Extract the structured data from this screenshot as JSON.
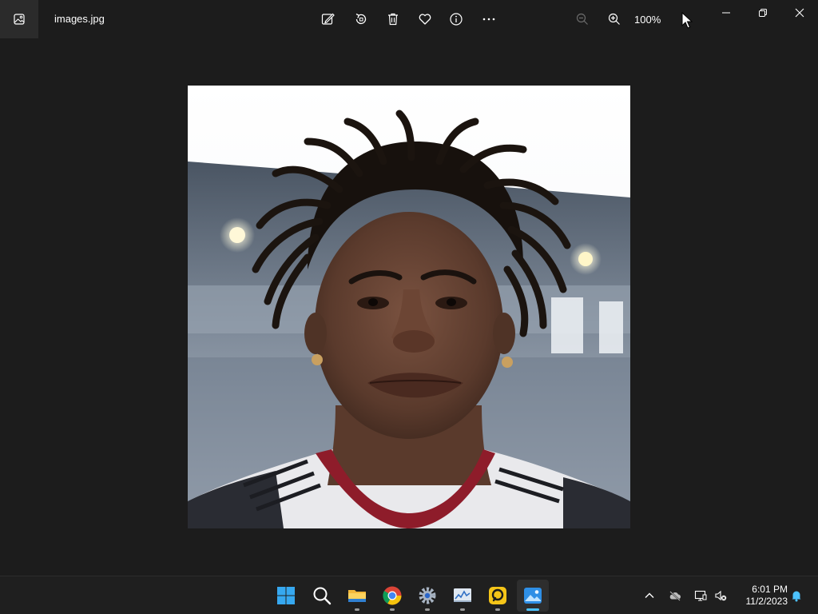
{
  "window": {
    "filename": "images.jpg",
    "zoom_level": "100%",
    "toolbar_icons": [
      "edit-image-icon",
      "rotate-icon",
      "delete-icon",
      "favorite-icon",
      "info-icon",
      "more-options-icon",
      "zoom-out-icon",
      "zoom-in-icon"
    ],
    "window_controls": [
      "minimize-icon",
      "restore-icon",
      "close-icon"
    ]
  },
  "taskbar": {
    "apps": [
      {
        "name": "start",
        "icon": "windows-logo-icon",
        "running": false
      },
      {
        "name": "search",
        "icon": "search-icon",
        "running": false
      },
      {
        "name": "file-explorer",
        "icon": "folder-icon",
        "running": true
      },
      {
        "name": "chrome",
        "icon": "chrome-icon",
        "running": true
      },
      {
        "name": "settings",
        "icon": "gear-icon",
        "running": true
      },
      {
        "name": "monitor",
        "icon": "chart-app-icon",
        "running": true
      },
      {
        "name": "app-yellow",
        "icon": "yellow-app-icon",
        "running": true
      },
      {
        "name": "photos",
        "icon": "photos-icon",
        "running": true,
        "active": true
      }
    ],
    "tray_icons": [
      "chevron-up-icon",
      "cloud-offline-icon",
      "network-icon",
      "speaker-muted-icon"
    ],
    "time": "6:01 PM",
    "date": "11/2/2023",
    "notification_icon": "bell-icon"
  },
  "colors": {
    "background": "#1c1c1c",
    "accent": "#4cc2ff",
    "taskbar": "#1f1f1f"
  }
}
